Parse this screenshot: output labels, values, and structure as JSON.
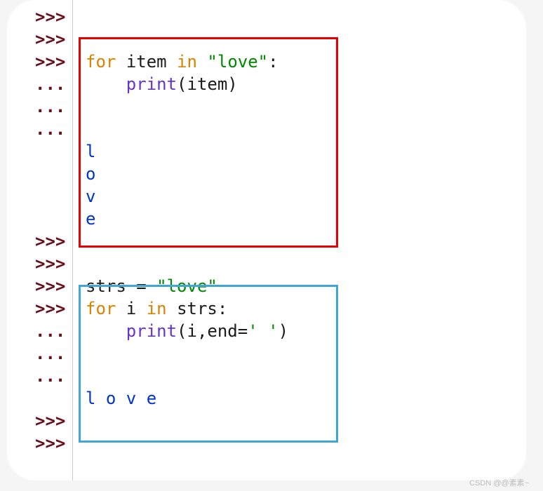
{
  "prompts": {
    "primary": ">>>",
    "continuation": "..."
  },
  "block1": {
    "line1": {
      "for": "for",
      "item": "item",
      "in": "in",
      "str": "\"love\"",
      "colon": ":"
    },
    "line2": {
      "indent": "    ",
      "func": "print",
      "open": "(",
      "arg": "item",
      "close": ")"
    },
    "output": [
      "l",
      "o",
      "v",
      "e"
    ]
  },
  "block2": {
    "line1": {
      "var": "strs",
      "eq": " = ",
      "str": "\"love\""
    },
    "line2": {
      "for": "for",
      "item": "i",
      "in": "in",
      "var": "strs",
      "colon": ":"
    },
    "line3": {
      "indent": "    ",
      "func": "print",
      "open": "(",
      "arg1": "i",
      "comma": ",",
      "kwarg": "end",
      "eq": "=",
      "str": "' '",
      "close": ")"
    },
    "output": "l o v e"
  },
  "watermark": "CSDN @@素素~"
}
